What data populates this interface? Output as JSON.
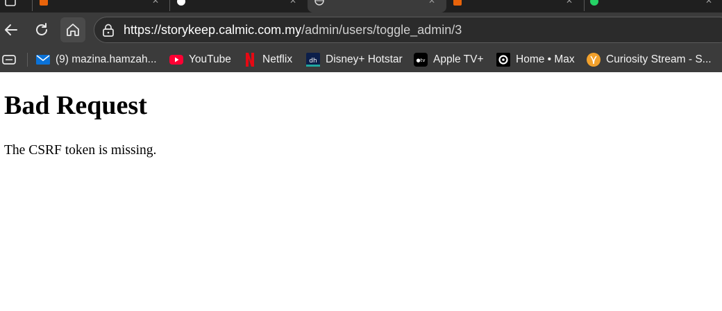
{
  "browser": {
    "tabs": [
      {
        "icon": "orange-tab-icon",
        "color": "#e8630a"
      },
      {
        "icon": "github-tab-icon",
        "color": "#ffffff"
      },
      {
        "icon": "globe-tab-icon",
        "color": "#d0d0d0",
        "active": true
      },
      {
        "icon": "orange-tab-icon",
        "color": "#e8630a"
      },
      {
        "icon": "whatsapp-tab-icon",
        "color": "#25d366"
      }
    ],
    "address_bar": {
      "url_host": "https://storykeep.calmic.com.my",
      "url_path": "/admin/users/toggle_admin/3"
    },
    "bookmarks": [
      {
        "label": "(9) mazina.hamzah...",
        "icon": "mail-icon",
        "color": "#0a72d8"
      },
      {
        "label": "YouTube",
        "icon": "youtube-icon",
        "color": "#ff0033"
      },
      {
        "label": "Netflix",
        "icon": "netflix-icon",
        "color": "#e50914"
      },
      {
        "label": "Disney+ Hotstar",
        "icon": "disney-hotstar-icon",
        "color": "#0c1f4a"
      },
      {
        "label": "Apple TV+",
        "icon": "apple-tv-icon",
        "color": "#000000"
      },
      {
        "label": "Home • Max",
        "icon": "max-icon",
        "color": "#000000"
      },
      {
        "label": "Curiosity Stream - S...",
        "icon": "curiosity-stream-icon",
        "color": "#f2a12c"
      }
    ]
  },
  "page": {
    "title": "Bad Request",
    "message": "The CSRF token is missing."
  }
}
